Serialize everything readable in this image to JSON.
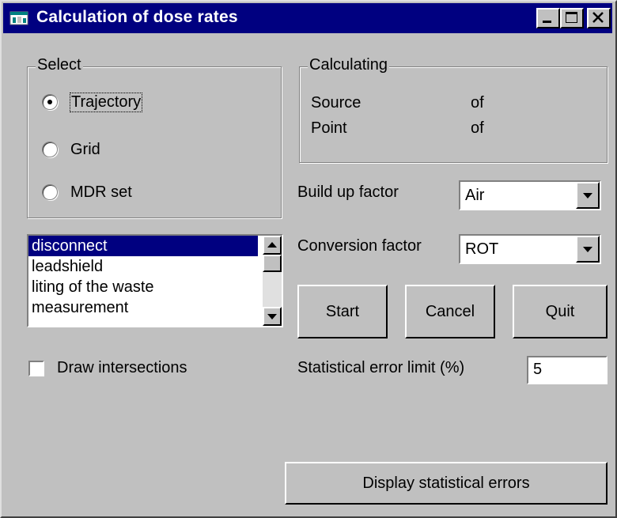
{
  "window": {
    "title": "Calculation of dose rates",
    "controls": [
      "minimize",
      "maximize",
      "close"
    ]
  },
  "select_group": {
    "legend": "Select",
    "options": [
      {
        "label": "Trajectory",
        "selected": true
      },
      {
        "label": "Grid",
        "selected": false
      },
      {
        "label": "MDR set",
        "selected": false
      }
    ]
  },
  "calculating_group": {
    "legend": "Calculating",
    "rows": [
      {
        "label": "Source",
        "of": "of"
      },
      {
        "label": "Point",
        "of": "of"
      }
    ]
  },
  "list": {
    "items": [
      "disconnect",
      "leadshield",
      "liting of the waste",
      "measurement"
    ],
    "selected_index": 0
  },
  "draw_intersections": {
    "label": "Draw intersections",
    "checked": false
  },
  "build_up": {
    "label": "Build up factor",
    "value": "Air"
  },
  "conversion": {
    "label": "Conversion factor",
    "value": "ROT"
  },
  "buttons": {
    "start": "Start",
    "cancel": "Cancel",
    "quit": "Quit"
  },
  "error_limit": {
    "label": "Statistical error limit (%)",
    "value": "5"
  },
  "display_errors": {
    "label": "Display statistical errors"
  },
  "colors": {
    "titlebar": "#000080",
    "face": "#c0c0c0",
    "selection": "#000080"
  }
}
